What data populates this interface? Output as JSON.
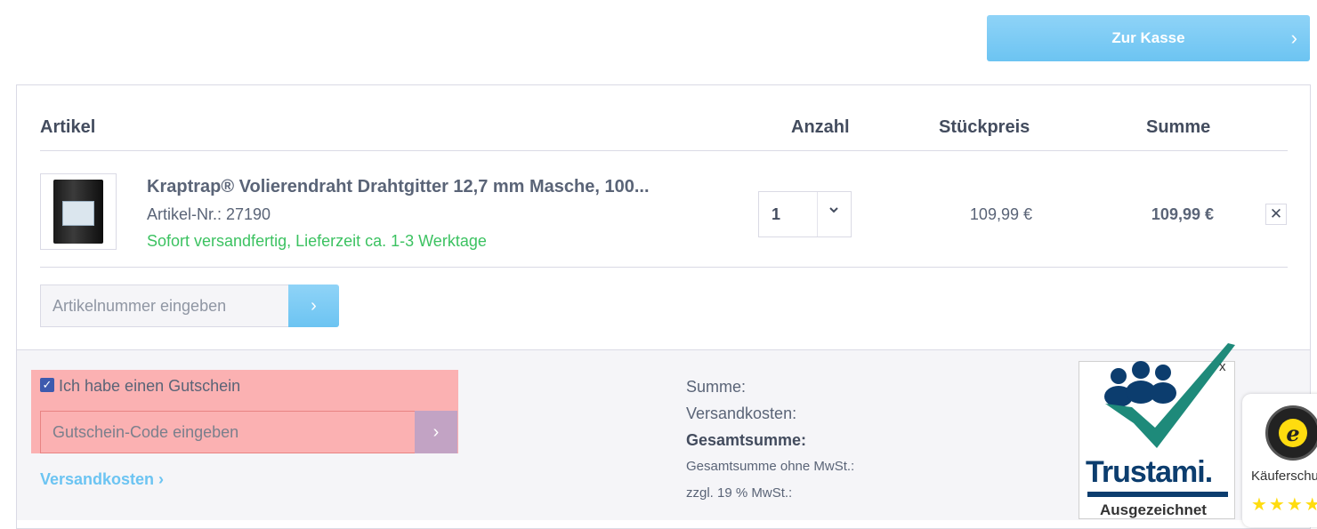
{
  "checkout": {
    "label": "Zur Kasse",
    "chevron": "›"
  },
  "table": {
    "headers": {
      "article": "Artikel",
      "quantity": "Anzahl",
      "unit_price": "Stückpreis",
      "sum": "Summe"
    }
  },
  "item": {
    "title": "Kraptrap® Volierendraht Drahtgitter 12,7 mm Masche, 100...",
    "article_number": "Artikel-Nr.: 27190",
    "shipping_status": "Sofort versandfertig, Lieferzeit ca. 1-3 Werktage",
    "quantity": "1",
    "unit_price": "109,99 €",
    "total": "109,99 €",
    "remove_symbol": "✕"
  },
  "article_entry": {
    "placeholder": "Artikelnummer eingeben",
    "button_symbol": "›"
  },
  "voucher": {
    "checkbox_label": "Ich habe einen Gutschein",
    "checked": true,
    "placeholder": "Gutschein-Code eingeben",
    "button_symbol": "›"
  },
  "shipping_link": "Versandkosten ›",
  "summary": {
    "sum_label": "Summe:",
    "shipping_label": "Versandkosten:",
    "grand_total_label": "Gesamtsumme:",
    "net_label": "Gesamtsumme ohne MwSt.:",
    "vat_label": "zzgl. 19 % MwSt.:"
  },
  "trustami": {
    "close": "x",
    "brand": "Trustami.",
    "award": "Ausgezeichnet"
  },
  "trusted_shops": {
    "label": "Käuferschutz",
    "stars": "★★★★★",
    "seal_letter": "e"
  },
  "colors": {
    "accent": "#6cc4f2",
    "success": "#3cc261",
    "text": "#5a6477",
    "highlight": "#ff7878"
  }
}
